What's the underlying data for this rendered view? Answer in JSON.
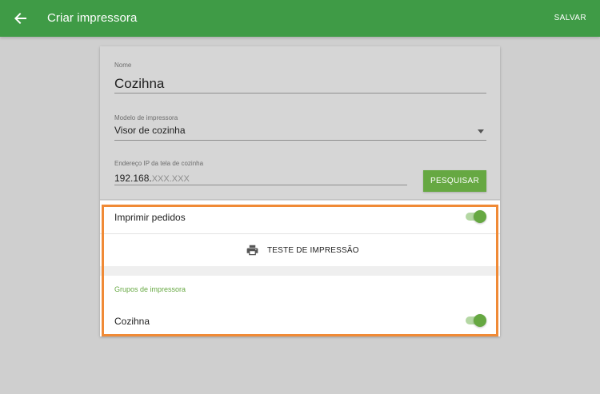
{
  "header": {
    "back_icon": "arrow-left-icon",
    "title": "Criar impressora",
    "save_label": "SALVAR",
    "color": "#3f9b46"
  },
  "form": {
    "name": {
      "label": "Nome",
      "value": "Cozihna"
    },
    "model": {
      "label": "Modelo de impressora",
      "value": "Visor de cozinha",
      "dropdown_icon": "arrow-drop-down-icon"
    },
    "ip": {
      "label": "Endereço IP da tela de cozinha",
      "typed": "192.168.",
      "placeholder": "XXX.XXX",
      "search_label": "PESQUISAR"
    }
  },
  "print_orders": {
    "label": "Imprimir pedidos",
    "enabled": true
  },
  "test_print": {
    "icon": "printer-icon",
    "label": "TESTE DE IMPRESSÃO"
  },
  "printer_groups": {
    "header": "Grupos de impressora",
    "items": [
      {
        "label": "Cozihna",
        "enabled": true
      }
    ]
  },
  "colors": {
    "accent": "#66a842",
    "highlight": "#f08a36"
  }
}
